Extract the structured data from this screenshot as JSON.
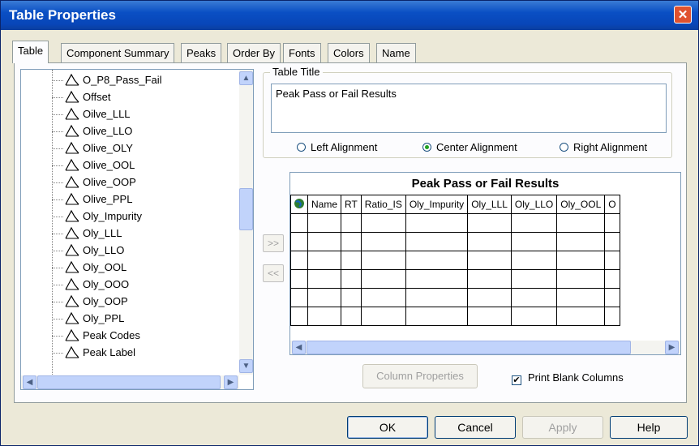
{
  "window": {
    "title": "Table Properties",
    "close_label": "✕"
  },
  "tabs": [
    "Table",
    "Component Summary",
    "Peaks",
    "Order By",
    "Fonts",
    "Colors",
    "Name"
  ],
  "tree": {
    "items": [
      "O_P8_Pass_Fail",
      "Offset",
      "Oilve_LLL",
      "Olive_LLO",
      "Olive_OLY",
      "Olive_OOL",
      "Olive_OOP",
      "Olive_PPL",
      "Oly_Impurity",
      "Oly_LLL",
      "Oly_LLO",
      "Oly_OOL",
      "Oly_OOO",
      "Oly_OOP",
      "Oly_PPL",
      "Peak Codes",
      "Peak Label"
    ]
  },
  "table_title": {
    "legend": "Table Title",
    "value": "Peak Pass or Fail Results"
  },
  "alignment": {
    "options": [
      "Left Alignment",
      "Center Alignment",
      "Right Alignment"
    ],
    "selected": "Center Alignment"
  },
  "move_buttons": {
    "add": ">>",
    "remove": "<<"
  },
  "grid": {
    "title": "Peak Pass or Fail Results",
    "columns": [
      "Name",
      "RT",
      "Ratio_IS",
      "Oly_Impurity",
      "Oly_LLL",
      "Oly_LLO",
      "Oly_OOL",
      "O"
    ]
  },
  "buttons": {
    "column_properties": "Column Properties",
    "print_blank_columns": "Print Blank Columns",
    "ok": "OK",
    "cancel": "Cancel",
    "apply": "Apply",
    "help": "Help"
  },
  "print_blank_columns_checked": true,
  "colors": {
    "title_bar": "#0a4fc4",
    "close_button": "#e0522f",
    "dialog_bg": "#ece9d8"
  }
}
